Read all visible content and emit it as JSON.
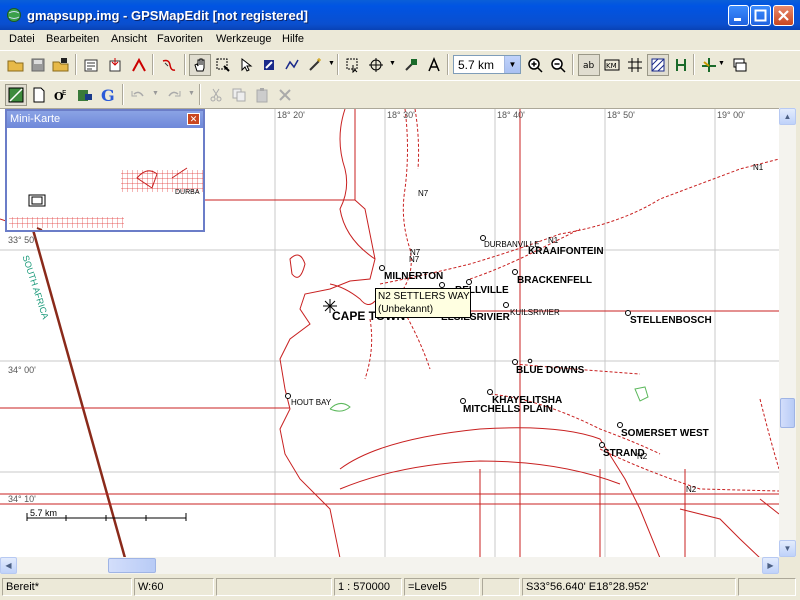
{
  "window": {
    "title": "gmapsupp.img - GPSMapEdit [not registered]"
  },
  "menu": {
    "items": [
      "Datei",
      "Bearbeiten",
      "Ansicht",
      "Favoriten",
      "Werkzeuge",
      "Hilfe"
    ]
  },
  "toolbar": {
    "zoom_value": "5.7 km",
    "icons": [
      "open-folder",
      "save",
      "open",
      "properties",
      "import",
      "export",
      "route",
      "hand-pan",
      "zoom-rect",
      "select",
      "edit-nodes",
      "polyline",
      "magic",
      "select-area",
      "transform",
      "pin",
      "label",
      "zoom-in",
      "zoom-out",
      "ab-labels",
      "km-grid",
      "grid",
      "hatch",
      "nodes",
      "routing",
      "layers"
    ]
  },
  "toolbar2": {
    "icons": [
      "map-view",
      "blank-page",
      "level",
      "img",
      "google",
      "undo",
      "redo",
      "cut",
      "copy",
      "paste",
      "delete"
    ]
  },
  "minimap": {
    "title": "Mini-Karte",
    "label": "DURBA"
  },
  "map": {
    "longitudes": [
      "18° 20'",
      "18° 30'",
      "18° 40'",
      "18° 50'",
      "19° 00'"
    ],
    "latitudes": [
      "33° 50'",
      "34° 00'",
      "34° 10'"
    ],
    "cities": [
      "MILNERTON",
      "CAPE TOWN",
      "BRACKENFELL",
      "KRAAIFONTEIN",
      "DURBANVILLE",
      "BELLVILLE",
      "KUILSRIVIER",
      "STELLENBOSCH",
      "BLUE DOWNS",
      "KHAYELITSHA",
      "MITCHELLS PLAIN",
      "HOUT BAY",
      "SOMERSET WEST",
      "STRAND",
      "ELSIESRIVIER"
    ],
    "roads": [
      "N7",
      "N7",
      "N7",
      "N1",
      "N1",
      "N2",
      "N2"
    ],
    "country_label": "SOUTH AFRICA",
    "scale_label": "5.7 km"
  },
  "tooltip": {
    "line1": "N2 SETTLERS WAY",
    "line2": "(Unbekannt)"
  },
  "status": {
    "state": "Bereit*",
    "w": "W:60",
    "scale": "1 : 570000",
    "level": "=Level5",
    "coords": "S33°56.640' E18°28.952'"
  }
}
